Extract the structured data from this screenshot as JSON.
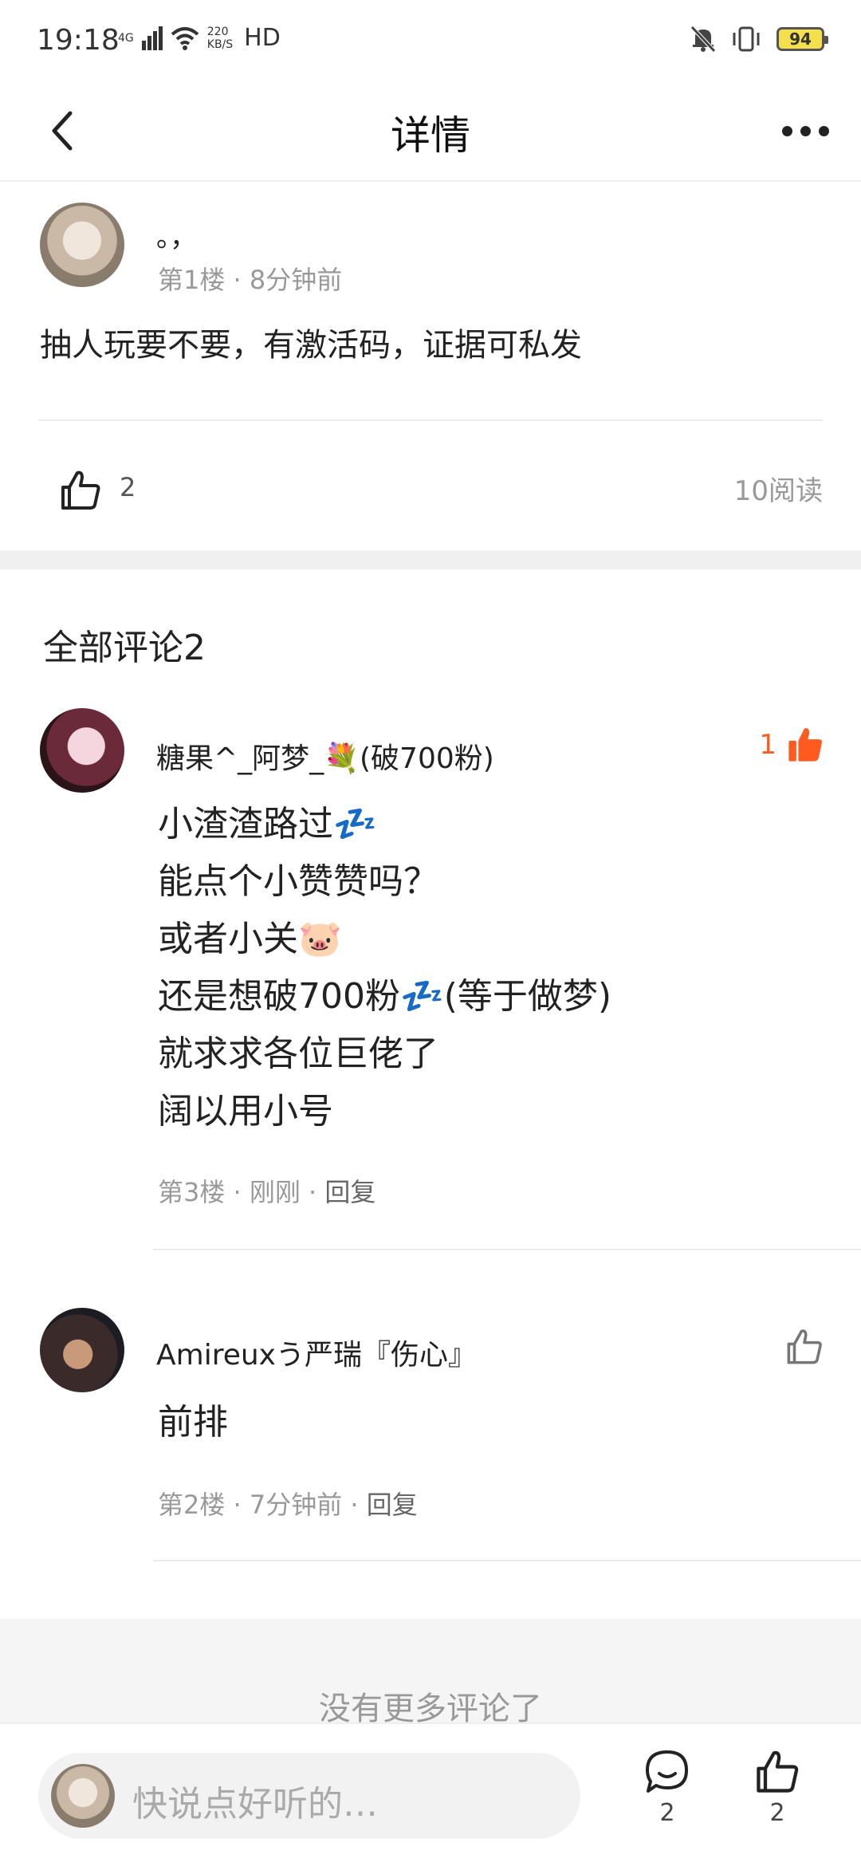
{
  "status_bar": {
    "time": "19:18",
    "network": "4G",
    "speed": "220",
    "speed_unit": "KB/S",
    "hd": "HD",
    "battery": "94"
  },
  "header": {
    "title": "详情"
  },
  "post": {
    "author": "。，",
    "meta": "第1楼 · 8分钟前",
    "body": "抽人玩要不要，有激活码，证据可私发",
    "likes": "2",
    "reads": "10阅读"
  },
  "comments": {
    "title": "全部评论2",
    "items": [
      {
        "name": "糖果^_阿梦_💐(破700粉)",
        "like_count": "1",
        "lines": [
          "小渣渣路过💤",
          "能点个小赞赞吗？",
          "或者小关🐷",
          "还是想破700粉💤(等于做梦)",
          "就求求各位巨佬了",
          "阔以用小号"
        ],
        "meta": "第3楼 · 刚刚 ·",
        "reply": "回复"
      },
      {
        "name": "Amireuxう严瑞『伤心』",
        "lines": [
          "前排"
        ],
        "meta": "第2楼 · 7分钟前 ·",
        "reply": "回复"
      }
    ]
  },
  "footer": {
    "no_more": "没有更多评论了"
  },
  "bottom_bar": {
    "placeholder": "快说点好听的…",
    "comment_count": "2",
    "like_count": "2"
  },
  "colors": {
    "accent": "#ff5a1f",
    "battery": "#f4e04d",
    "muted": "#999999"
  },
  "icons": [
    "back-arrow-icon",
    "more-dots-icon",
    "thumb-up-icon",
    "thumb-up-filled-icon",
    "comment-bubble-icon",
    "mute-bell-icon",
    "vibrate-icon",
    "wifi-icon",
    "signal-icon"
  ]
}
